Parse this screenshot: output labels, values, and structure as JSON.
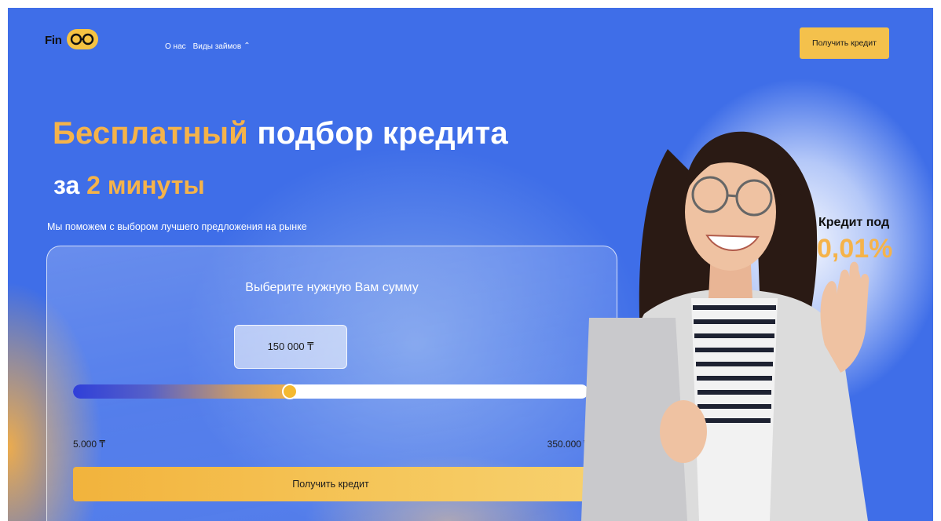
{
  "header": {
    "logo_text": "Fin",
    "nav": [
      "О нас",
      "Виды займов"
    ],
    "nav_chevron": "chevron-down-icon",
    "cta_label": "Получить кредит"
  },
  "hero": {
    "title_accent": "Бесплатный",
    "title_rest": "подбор кредита",
    "subtitle_prefix": "за",
    "subtitle_accent": "2 минуты",
    "description": "Мы поможем с выбором лучшего предложения на рынке"
  },
  "calculator": {
    "title": "Выберите нужную Вам сумму",
    "amount": "150 000 ₸",
    "min_label": "5.000 ₸",
    "max_label": "350.000 ₸",
    "min_value": 5000,
    "max_value": 350000,
    "value": 150000,
    "button_label": "Получить кредит"
  },
  "promo": {
    "line1": "Кредит под",
    "rate": "0,01%"
  },
  "colors": {
    "background": "#3f6ee8",
    "accent": "#f5b34a",
    "button": "#f4c14c"
  }
}
